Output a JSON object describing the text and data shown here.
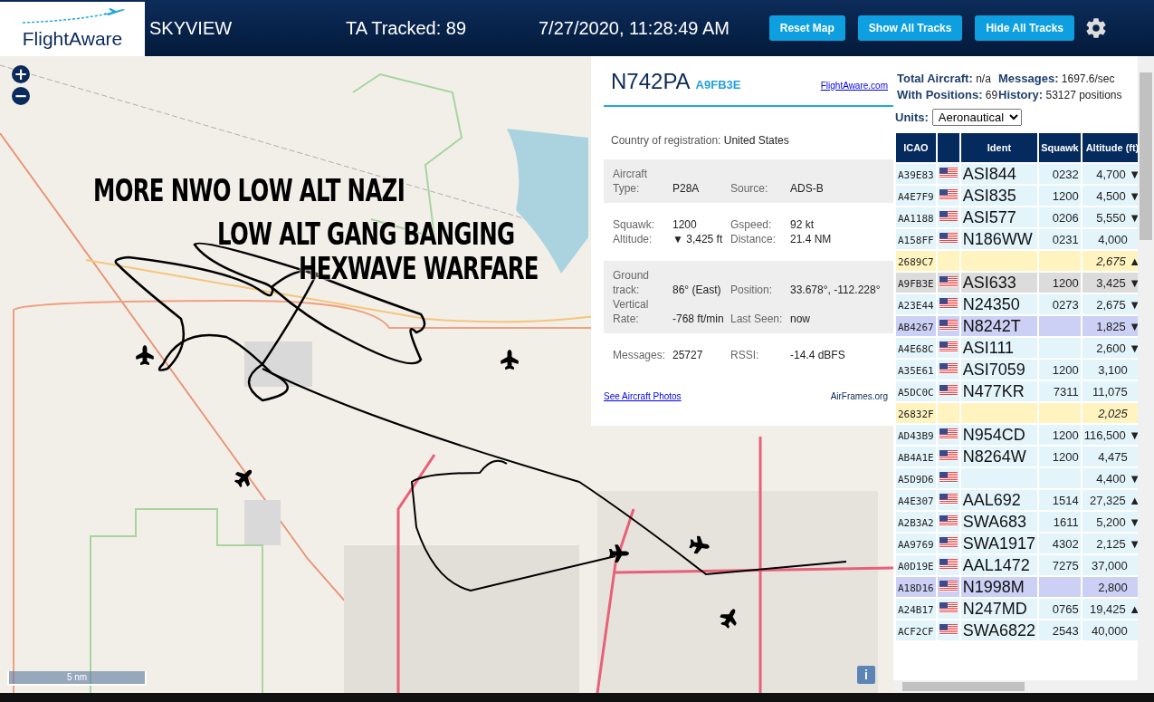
{
  "header": {
    "logo": "FlightAware",
    "title": "SKYVIEW",
    "tracked": "TA Tracked: 89",
    "datetime": "7/27/2020, 11:28:49 AM",
    "buttons": [
      "Reset Map",
      "Show All Tracks",
      "Hide All Tracks"
    ]
  },
  "map": {
    "zoom_buttons": [
      "+",
      "−"
    ],
    "scale": "5 nm",
    "info_button": "i",
    "overlay_texts": [
      "MORE NWO LOW ALT NAZI",
      "LOW ALT GANG BANGING",
      "HEXWAVE WARFARE"
    ]
  },
  "info": {
    "ident": "N742PA",
    "hex": "A9FB3E",
    "link": "FlightAware.com",
    "country_label": "Country of registration:",
    "country": "United States",
    "sections": [
      {
        "shaded": true,
        "rows": [
          [
            {
              "label": "Aircraft Type:",
              "value": "P28A"
            },
            {
              "label": "Source:",
              "value": "ADS-B"
            }
          ]
        ]
      },
      {
        "shaded": false,
        "rows": [
          [
            {
              "label": "Squawk:",
              "value": "1200"
            },
            {
              "label": "Gspeed:",
              "value": "92 kt"
            }
          ],
          [
            {
              "label": "Altitude:",
              "value": "▼ 3,425 ft"
            },
            {
              "label": "Distance:",
              "value": "21.4 NM"
            }
          ]
        ]
      },
      {
        "shaded": true,
        "rows": [
          [
            {
              "label": "Ground track:",
              "value": "86° (East)"
            },
            {
              "label": "Position:",
              "value": "33.678°, -112.228°"
            }
          ],
          [
            {
              "label": "Vertical Rate:",
              "value": "-768 ft/min"
            },
            {
              "label": "Last Seen:",
              "value": "now"
            }
          ]
        ]
      },
      {
        "shaded": false,
        "rows": [
          [
            {
              "label": "Messages:",
              "value": "25727"
            },
            {
              "label": "RSSI:",
              "value": "-14.4 dBFS"
            }
          ]
        ]
      }
    ],
    "photos_link": "See Aircraft Photos",
    "airframes_link": "AirFrames.org"
  },
  "stats": [
    {
      "label": "Total Aircraft:",
      "value": "n/a"
    },
    {
      "label": "Messages:",
      "value": "1697.6/sec"
    },
    {
      "label": "With Positions:",
      "value": "69"
    },
    {
      "label": "History:",
      "value": "53127 positions"
    }
  ],
  "units": {
    "label": "Units:",
    "value": "Aeronautical"
  },
  "table": {
    "columns": [
      "ICAO",
      "",
      "Ident",
      "Squawk",
      "Altitude (ft)"
    ],
    "rows": [
      {
        "icao": "A39E83",
        "flag": true,
        "ident": "ASI844",
        "squawk": "0232",
        "altitude": "4,700",
        "trend": "▼",
        "kind": "normal",
        "selected": false
      },
      {
        "icao": "A4E7F9",
        "flag": true,
        "ident": "ASI835",
        "squawk": "1200",
        "altitude": "4,500",
        "trend": "▼",
        "kind": "normal",
        "selected": false
      },
      {
        "icao": "AA1188",
        "flag": true,
        "ident": "ASI577",
        "squawk": "0206",
        "altitude": "5,550",
        "trend": "▼",
        "kind": "normal",
        "selected": false
      },
      {
        "icao": "A158FF",
        "flag": true,
        "ident": "N186WW",
        "squawk": "0231",
        "altitude": "4,000",
        "kind": "normal",
        "selected": false
      },
      {
        "icao": "2689C7",
        "flag": false,
        "altitude": "2,675",
        "trend": "▲",
        "kind": "no_position",
        "selected": false
      },
      {
        "icao": "A9FB3E",
        "flag": true,
        "ident": "ASI633",
        "squawk": "1200",
        "altitude": "3,425",
        "trend": "▼",
        "kind": "normal",
        "selected": true
      },
      {
        "icao": "A23E44",
        "flag": true,
        "ident": "N24350",
        "squawk": "0273",
        "altitude": "2,675",
        "trend": "▼",
        "kind": "normal",
        "selected": false
      },
      {
        "icao": "AB4267",
        "flag": true,
        "ident": "N8242T",
        "altitude": "1,825",
        "trend": "▼",
        "kind": "highlighted",
        "selected": false
      },
      {
        "icao": "A4E68C",
        "flag": true,
        "ident": "ASI111",
        "altitude": "2,600",
        "trend": "▼",
        "kind": "normal",
        "selected": false
      },
      {
        "icao": "A35E61",
        "flag": true,
        "ident": "ASI7059",
        "squawk": "1200",
        "altitude": "3,100",
        "kind": "normal",
        "selected": false
      },
      {
        "icao": "A5DC0C",
        "flag": true,
        "ident": "N477KR",
        "squawk": "7311",
        "altitude": "11,075",
        "kind": "normal",
        "selected": false
      },
      {
        "icao": "26832F",
        "flag": false,
        "altitude": "2,025",
        "kind": "no_position",
        "selected": false
      },
      {
        "icao": "AD43B9",
        "flag": true,
        "ident": "N954CD",
        "squawk": "1200",
        "altitude": "116,500",
        "trend": "▼",
        "kind": "normal",
        "selected": false
      },
      {
        "icao": "AB4A1E",
        "flag": true,
        "ident": "N8264W",
        "squawk": "1200",
        "altitude": "4,475",
        "kind": "normal",
        "selected": false
      },
      {
        "icao": "A5D9D6",
        "flag": true,
        "altitude": "4,400",
        "trend": "▼",
        "kind": "normal",
        "selected": false
      },
      {
        "icao": "A4E307",
        "flag": true,
        "ident": "AAL692",
        "squawk": "1514",
        "altitude": "27,325",
        "trend": "▲",
        "kind": "normal",
        "selected": false
      },
      {
        "icao": "A2B3A2",
        "flag": true,
        "ident": "SWA683",
        "squawk": "1611",
        "altitude": "5,200",
        "trend": "▼",
        "kind": "normal",
        "selected": false
      },
      {
        "icao": "AA9769",
        "flag": true,
        "ident": "SWA1917",
        "squawk": "4302",
        "altitude": "2,125",
        "trend": "▼",
        "kind": "normal",
        "selected": false
      },
      {
        "icao": "A0D19E",
        "flag": true,
        "ident": "AAL1472",
        "squawk": "7275",
        "altitude": "37,000",
        "kind": "normal",
        "selected": false
      },
      {
        "icao": "A18D16",
        "flag": true,
        "ident": "N1998M",
        "altitude": "2,800",
        "kind": "highlighted",
        "selected": false
      },
      {
        "icao": "A24B17",
        "flag": true,
        "ident": "N247MD",
        "squawk": "0765",
        "altitude": "19,425",
        "trend": "▲",
        "kind": "normal",
        "selected": false
      },
      {
        "icao": "ACF2CF",
        "flag": true,
        "ident": "SWA6822",
        "squawk": "2543",
        "altitude": "40,000",
        "kind": "normal",
        "selected": false
      }
    ]
  }
}
